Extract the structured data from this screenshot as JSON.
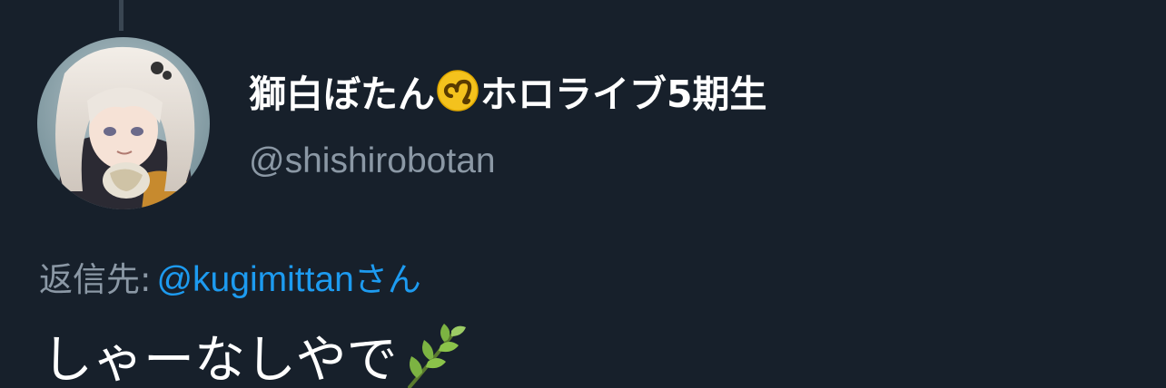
{
  "author": {
    "name_main": "獅白ぼたん",
    "name_tail": "ホロライブ5期生",
    "handle": "@shishirobotan",
    "name_emoji": "leo-zodiac-icon"
  },
  "reply": {
    "prefix": "返信先:",
    "target_handle": "@kugimittan",
    "target_suffix": "さん"
  },
  "tweet": {
    "text": "しゃーなしやで",
    "emoji": "herb-icon"
  },
  "colors": {
    "background": "#17202b",
    "primary_text": "#ffffff",
    "secondary_text": "#8b98a5",
    "link": "#1d9bf0",
    "thread_line": "#3a4652"
  }
}
